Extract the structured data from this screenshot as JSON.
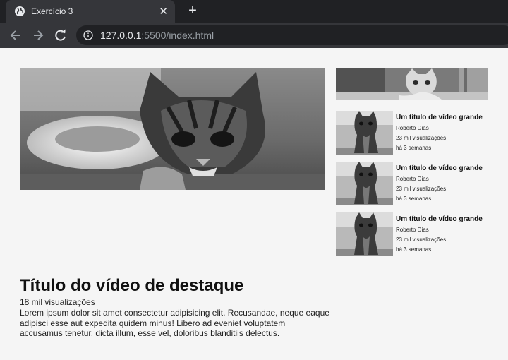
{
  "browser": {
    "tab_title": "Exercício 3",
    "close_glyph": "✕",
    "new_tab_glyph": "+",
    "url_host": "127.0.0.1",
    "url_rest": ":5500/index.html",
    "icons": [
      "globe-icon",
      "close-icon",
      "plus-icon",
      "back-arrow-icon",
      "forward-arrow-icon",
      "reload-icon",
      "info-icon"
    ]
  },
  "featured": {
    "title": "Título do vídeo de destaque",
    "views": "18 mil visualizações",
    "description": "Lorem ipsum dolor sit amet consectetur adipisicing elit. Recusandae, neque eaque adipisci esse aut expedita quidem minus! Libero ad eveniet voluptatem accusamus tenetur, dicta illum, esse vel, doloribus blanditiis delectus."
  },
  "videos": [
    {
      "title": "Um título de vídeo grande",
      "author": "Roberto Dias",
      "views": "23 mil visualizações",
      "age": "há 3 semanas"
    },
    {
      "title": "Um título de vídeo grande",
      "author": "Roberto Dias",
      "views": "23 mil visualizações",
      "age": "há 3 semanas"
    },
    {
      "title": "Um título de vídeo grande",
      "author": "Roberto Dias",
      "views": "23 mil visualizações",
      "age": "há 3 semanas"
    }
  ]
}
